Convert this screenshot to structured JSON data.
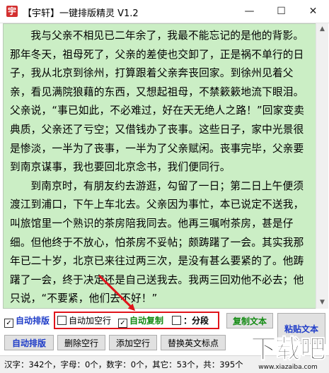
{
  "window": {
    "title": "【宇轩】一键排版精灵 V1.2",
    "icon_name": "app-logo-icon",
    "minimize_glyph": "—",
    "maximize_glyph": "☐",
    "close_glyph": "✕"
  },
  "editor": {
    "background": "#cbeec5",
    "paragraphs": [
      "我与父亲不相见已二年余了，我最不能忘记的是他的背影。那年冬天，祖母死了，父亲的差使也交卸了，正是祸不单行的日子，我从北京到徐州，打算跟着父亲奔丧回家。到徐州见着父亲，看见满院狼藉的东西，又想起祖母，不禁簌簌地流下眼泪。父亲说，“事已如此，不必难过，好在天无绝人之路！”回家变卖典质，父亲还了亏空；又借钱办了丧事。这些日子，家中光景很是惨淡，一半为了丧事，一半为了父亲赋闲。丧事完毕，父亲要到南京谋事，我也要回北京念书，我们便同行。",
      "到南京时，有朋友约去游逛，勾留了一日；第二日上午便须渡江到浦口，下午上车北去。父亲因为事忙，本已说定不送我，叫旅馆里一个熟识的茶房陪我同去。他再三嘱咐茶房，甚是仔细。但他终于不放心，怕茶房不妥帖；颇踌躇了一会。其实我那年已二十岁，北京已来往过两三次，是没有甚么要紧的了。他踌躇了一会，终于决定还是自己送我去。我两三回劝他不必去；他只说，“不要紧，他们去不好！”"
    ]
  },
  "scrollbar": {
    "up_glyph": "▲",
    "down_glyph": "▼"
  },
  "options": {
    "auto_format": {
      "label": "自动排版",
      "checked": true,
      "check_glyph": "✓"
    },
    "auto_blank_line": {
      "label": "自动加空行",
      "checked": false
    },
    "auto_copy": {
      "label": "自动复制",
      "checked": true,
      "check_glyph": "✓"
    },
    "split": {
      "label": "：分段",
      "prefix": "：",
      "checked": false
    }
  },
  "buttons": {
    "copy_text": "复制文本",
    "paste_text": "粘贴文本",
    "auto_format": "自动排版",
    "delete_blank_lines": "删除空行",
    "add_blank_lines": "添加空行",
    "replace_punct": "替换英文标点"
  },
  "status": {
    "text": "汉字：342个，字母：0个，数字：0个，其它：53个，共：395个"
  },
  "watermark": {
    "main": "下载吧",
    "sub": "www.xiazaiba.com"
  },
  "colors": {
    "highlight_box": "#e0141a",
    "arrow": "#e0141a",
    "accent_blue": "#1e3cc8",
    "accent_green": "#118a11"
  }
}
